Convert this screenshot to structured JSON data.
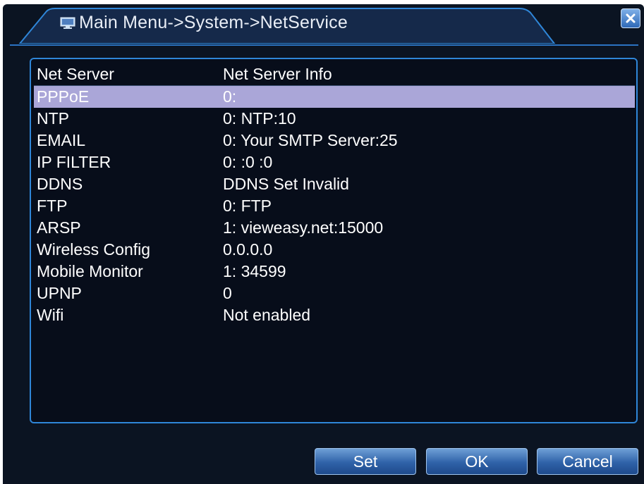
{
  "window": {
    "title": "Main Menu->System->NetService"
  },
  "table": {
    "headers": [
      "Net Server",
      "Net Server Info"
    ],
    "rows": [
      {
        "name": "PPPoE",
        "info": "0:"
      },
      {
        "name": "NTP",
        "info": "0: NTP:10"
      },
      {
        "name": "EMAIL",
        "info": "0: Your SMTP Server:25"
      },
      {
        "name": "IP FILTER",
        "info": "0: :0 :0"
      },
      {
        "name": "DDNS",
        "info": "DDNS Set Invalid"
      },
      {
        "name": "FTP",
        "info": "0: FTP"
      },
      {
        "name": "ARSP",
        "info": "1: vieweasy.net:15000"
      },
      {
        "name": "Wireless Config",
        "info": "0.0.0.0"
      },
      {
        "name": "Mobile Monitor",
        "info": "1: 34599"
      },
      {
        "name": "UPNP",
        "info": "0"
      },
      {
        "name": "Wifi",
        "info": "Not enabled"
      }
    ],
    "selected_row": 0
  },
  "buttons": {
    "set": "Set",
    "ok": "OK",
    "cancel": "Cancel"
  },
  "icons": {
    "title": "monitor-icon",
    "close": "close-icon"
  },
  "colors": {
    "background": "#0b1422",
    "accent": "#2f86d8",
    "selection": "#aaa6d8",
    "text": "#ffffff"
  }
}
